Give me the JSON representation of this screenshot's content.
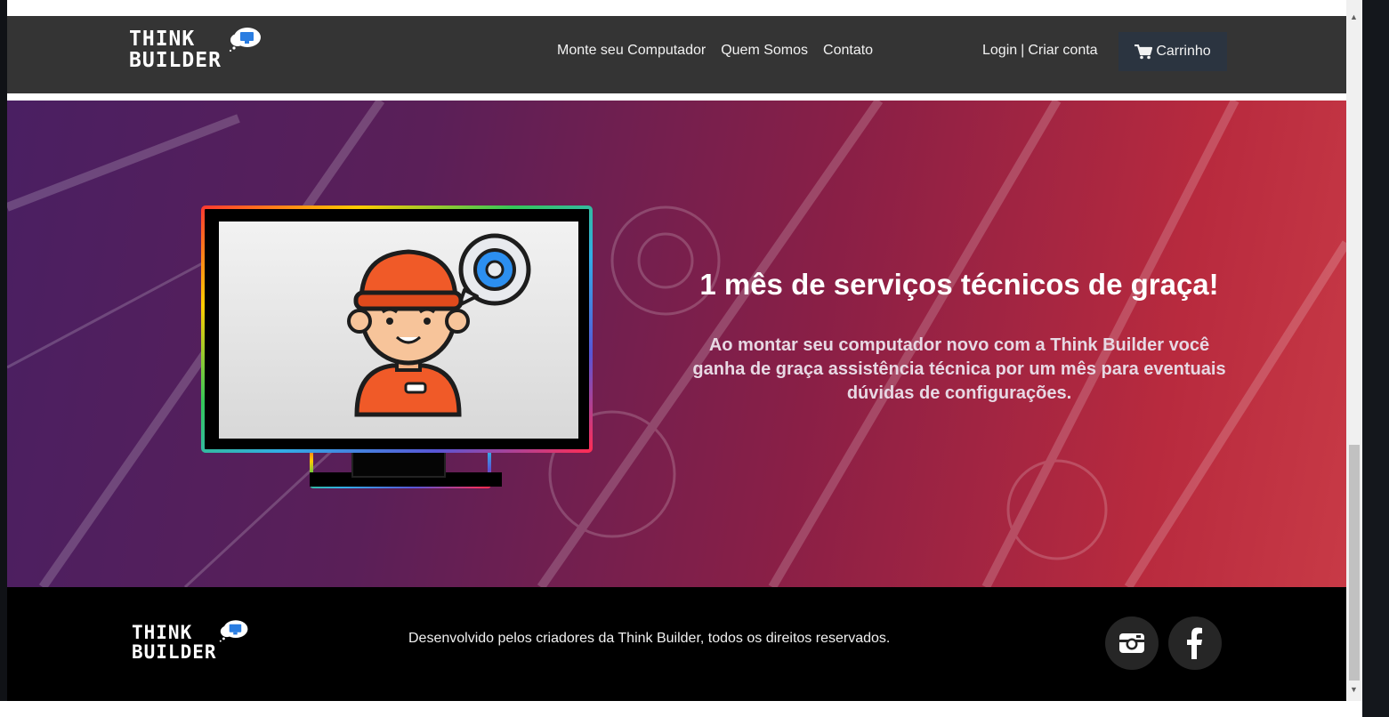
{
  "brand": {
    "line1": "THINK",
    "line2": "BUILDER"
  },
  "nav": {
    "links": [
      "Monte seu Computador",
      "Quem Somos",
      "Contato"
    ],
    "login": "Login",
    "separator": "|",
    "signup": "Criar conta",
    "cart_label": "Carrinho",
    "cart_icon": "shopping-cart-icon"
  },
  "hero": {
    "title": "1 mês de serviços técnicos de graça!",
    "text": "Ao montar seu computador novo com a Think Builder você ganha de graça assistência técnica por um mês para eventuais dúvidas de configurações.",
    "image": "technician-on-monitor-illustration"
  },
  "footer": {
    "text": "Desenvolvido pelos criadores da Think Builder, todos os direitos reservados.",
    "social": [
      {
        "name": "instagram-icon"
      },
      {
        "name": "facebook-icon"
      }
    ]
  },
  "colors": {
    "navbar": "#343434",
    "cart_button": "#2b3440",
    "hero_start": "#4a1f62",
    "hero_end": "#c83a46",
    "footer": "#000000"
  }
}
